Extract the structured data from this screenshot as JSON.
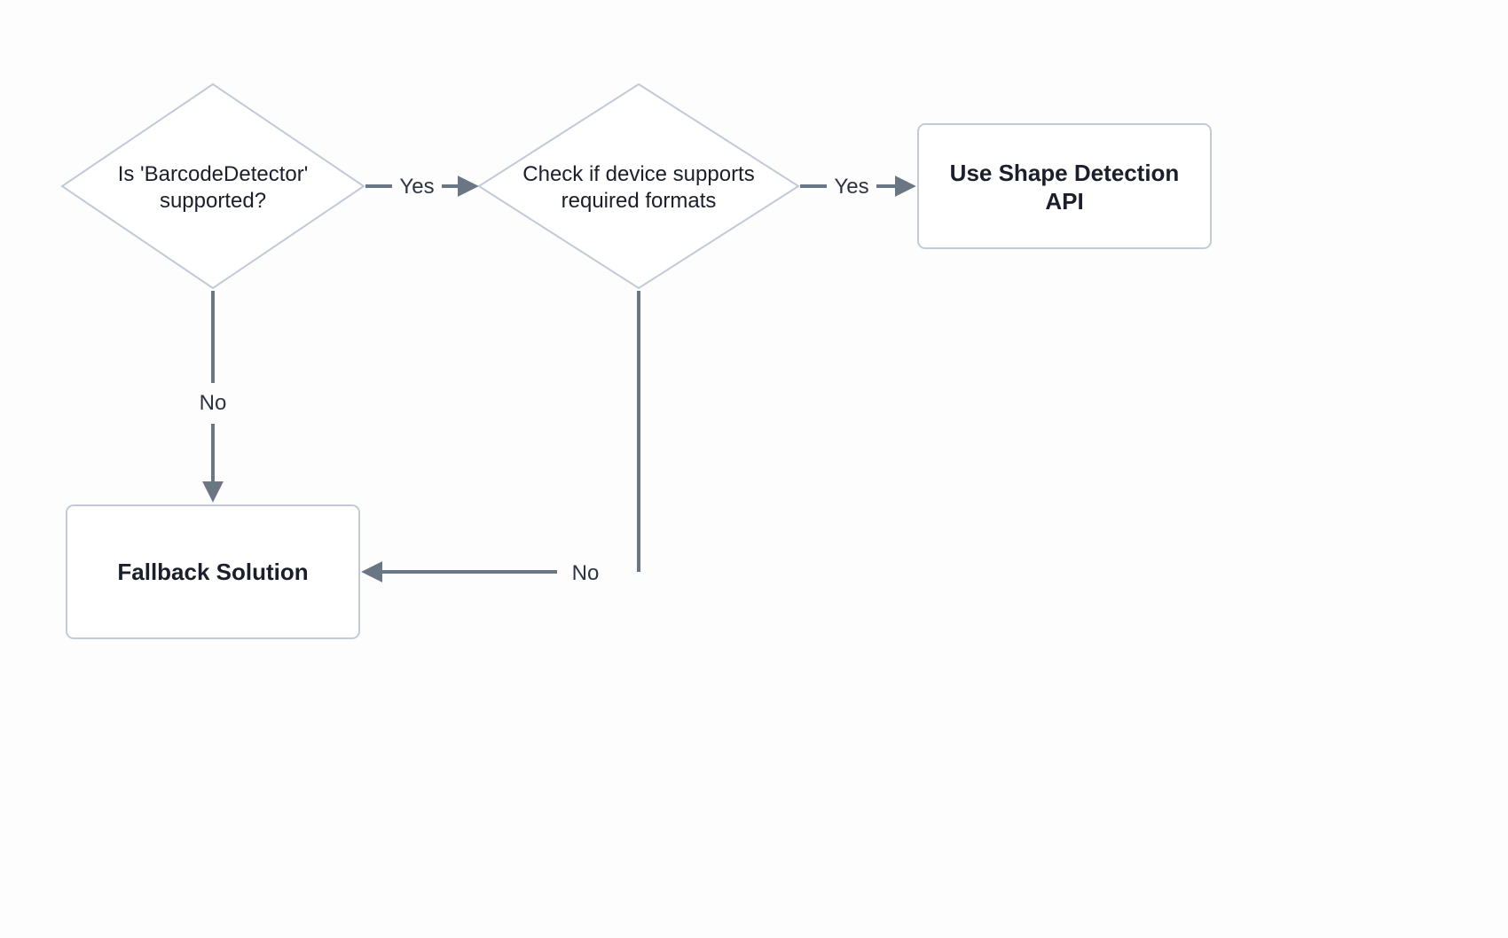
{
  "diagram": {
    "type": "flowchart",
    "nodes": {
      "decision1": {
        "line1": "Is 'BarcodeDetector'",
        "line2": "supported?"
      },
      "decision2": {
        "line1": "Check if device supports",
        "line2": "required formats"
      },
      "result_api": {
        "line1": "Use Shape Detection",
        "line2": "API"
      },
      "result_fallback": "Fallback Solution"
    },
    "edges": {
      "d1_yes": "Yes",
      "d1_no": "No",
      "d2_yes": "Yes",
      "d2_no": "No"
    }
  }
}
